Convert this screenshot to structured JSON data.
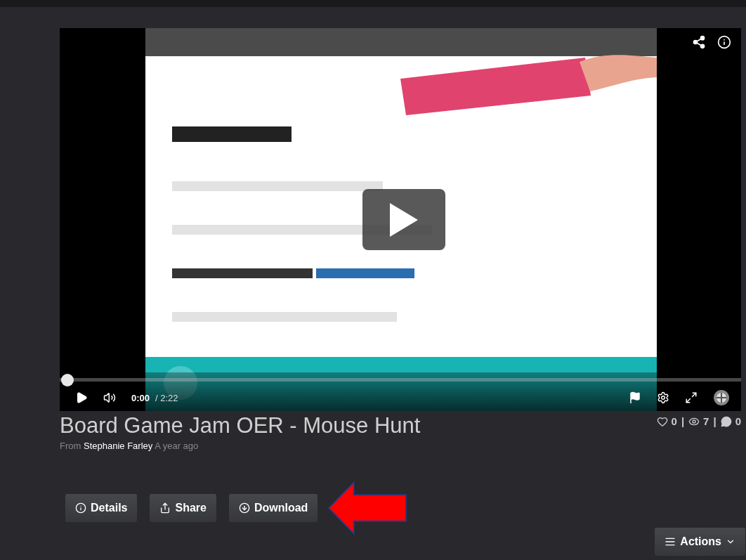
{
  "video": {
    "progress": {
      "level": 0
    },
    "time_current": "0:00",
    "time_total": "/ 2:22"
  },
  "title": "Board Game Jam OER - Mouse Hunt",
  "stats": [
    {
      "kind": "likes",
      "count": "0"
    },
    {
      "kind": "separator",
      "text": "|"
    },
    {
      "kind": "views",
      "count": "7"
    },
    {
      "kind": "separator",
      "text": "|"
    },
    {
      "kind": "comments",
      "count": "0"
    }
  ],
  "byline": {
    "prefix": "From",
    "author": "Stephanie Farley",
    "time": "A year ago"
  },
  "buttons": [
    {
      "kind": "details",
      "label": "Details"
    },
    {
      "kind": "share",
      "label": "Share"
    },
    {
      "kind": "download",
      "label": "Download"
    }
  ],
  "actions_button": {
    "label": "Actions"
  }
}
